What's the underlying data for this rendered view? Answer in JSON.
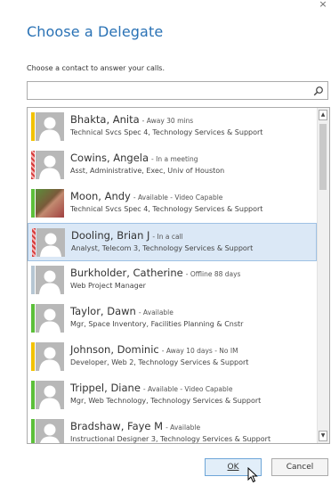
{
  "dialog": {
    "title": "Choose a Delegate",
    "instruction": "Choose a contact to answer your calls.",
    "search": {
      "value": "",
      "placeholder": "",
      "icon": "search-icon"
    },
    "close_label": "×"
  },
  "contacts": [
    {
      "name": "Bhakta, Anita",
      "status": "- Away 30 mins",
      "detail": "Technical Svcs Spec 4, Technology Services & Support",
      "presence": "away",
      "presence_color": "#f2c200",
      "photo": false
    },
    {
      "name": "Cowins, Angela",
      "status": "- In a meeting",
      "detail": "Asst, Administrative, Exec, Univ of Houston",
      "presence": "busy",
      "presence_color": "#d63a3a",
      "photo": false
    },
    {
      "name": "Moon, Andy",
      "status": "- Available - Video Capable",
      "detail": "Technical Svcs Spec 4, Technology Services & Support",
      "presence": "available",
      "presence_color": "#5cbf3a",
      "photo": true
    },
    {
      "name": "Dooling, Brian J",
      "status": "- In a call",
      "detail": "Analyst, Telecom 3, Technology Services & Support",
      "presence": "busy",
      "presence_color": "#d63a3a",
      "photo": false,
      "selected": true
    },
    {
      "name": "Burkholder, Catherine",
      "status": "- Offline 88 days",
      "detail": "Web Project Manager",
      "presence": "offline",
      "presence_color": "#b6c6d3",
      "photo": false
    },
    {
      "name": "Taylor, Dawn",
      "status": "- Available",
      "detail": "Mgr, Space Inventory, Facilities Planning & Cnstr",
      "presence": "available",
      "presence_color": "#5cbf3a",
      "photo": false
    },
    {
      "name": "Johnson, Dominic",
      "status": "- Away 10 days - No IM",
      "detail": "Developer, Web 2, Technology Services & Support",
      "presence": "away",
      "presence_color": "#f2c200",
      "photo": false
    },
    {
      "name": "Trippel, Diane",
      "status": "- Available - Video Capable",
      "detail": "Mgr, Web Technology, Technology Services & Support",
      "presence": "available",
      "presence_color": "#5cbf3a",
      "photo": false
    },
    {
      "name": "Bradshaw, Faye M",
      "status": "- Available",
      "detail": "Instructional Designer 3, Technology Services & Support",
      "presence": "available",
      "presence_color": "#5cbf3a",
      "photo": false
    }
  ],
  "buttons": {
    "ok_label": "OK",
    "cancel_label": "Cancel"
  },
  "colors": {
    "accent": "#2a72b5",
    "selected_row": "#dbe8f6"
  }
}
